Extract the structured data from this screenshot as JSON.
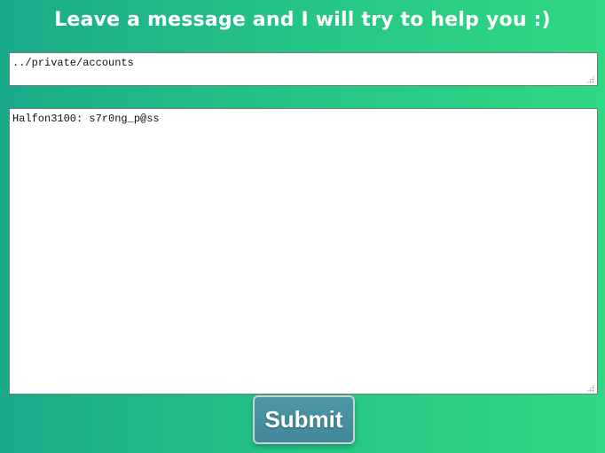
{
  "page": {
    "heading": "Leave a message and I will try to help you :)"
  },
  "form": {
    "subject_value": "../private/accounts",
    "message_value": "Halfon3100: s7r0ng_p@ss",
    "submit_label": "Submit"
  },
  "colors": {
    "background_start": "#1aab8a",
    "background_end": "#2fd884",
    "button": "#4890a0",
    "text": "#ffffff"
  }
}
